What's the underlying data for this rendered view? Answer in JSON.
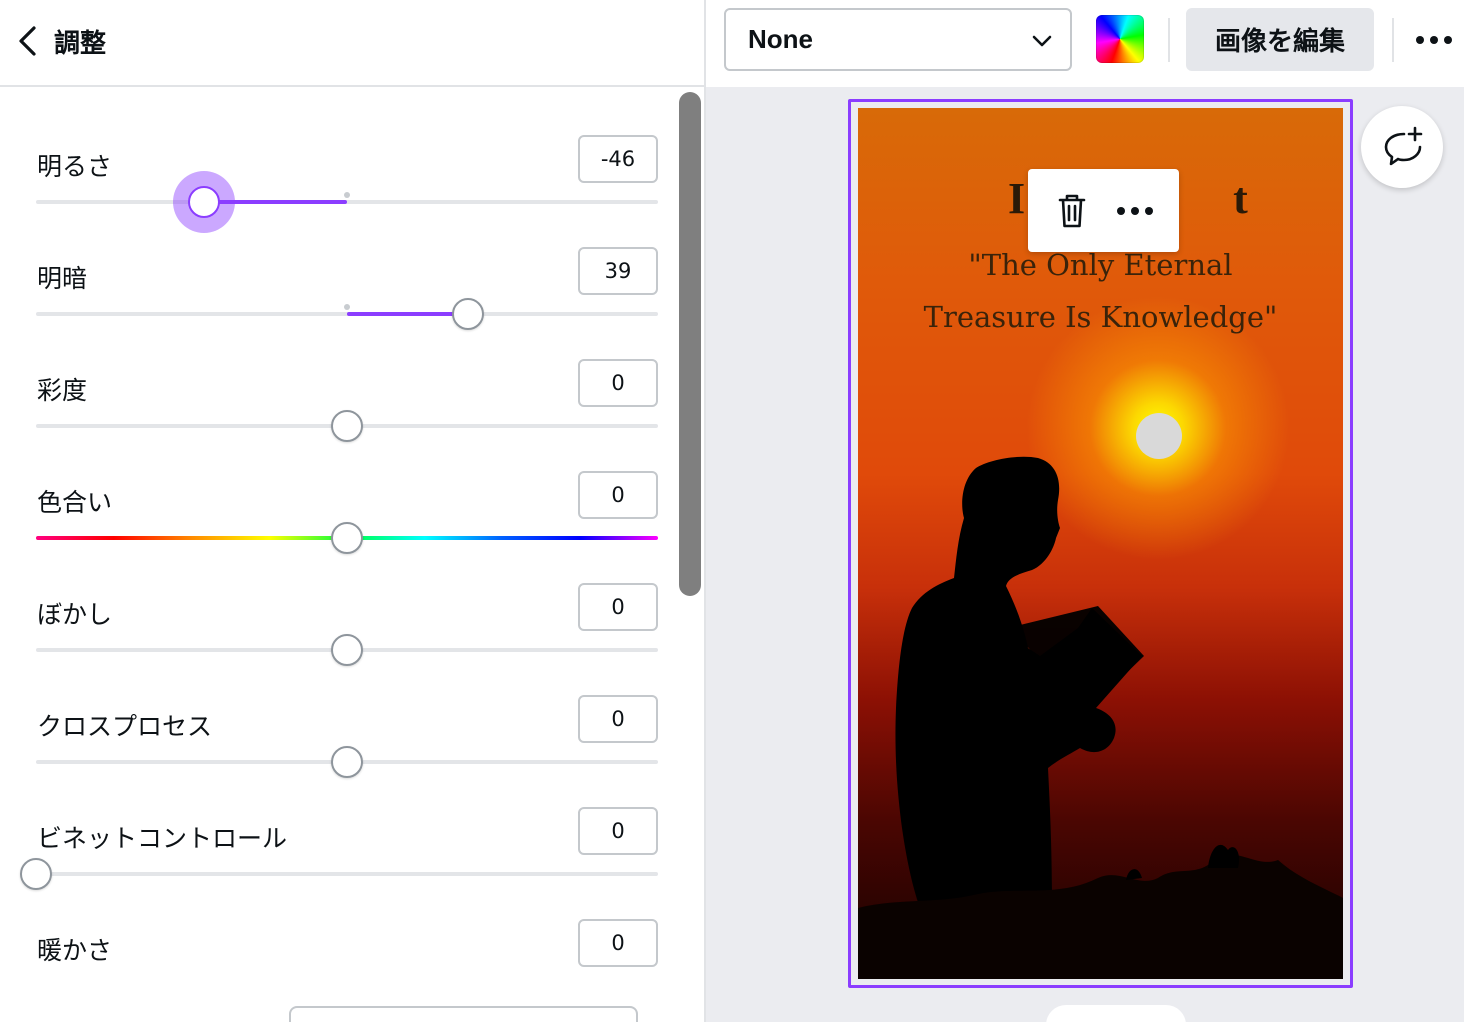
{
  "panel": {
    "title": "調整",
    "back_icon": "chevron-left-icon"
  },
  "adjustments": [
    {
      "id": "brightness",
      "label": "明るさ",
      "value": "-46",
      "level": -46
    },
    {
      "id": "contrast",
      "label": "明暗",
      "value": "39",
      "level": 39
    },
    {
      "id": "saturation",
      "label": "彩度",
      "value": "0",
      "level": 0
    },
    {
      "id": "hue",
      "label": "色合い",
      "value": "0",
      "level": 0
    },
    {
      "id": "blur",
      "label": "ぼかし",
      "value": "0",
      "level": 0
    },
    {
      "id": "xpro",
      "label": "クロスプロセス",
      "value": "0",
      "level": 0
    },
    {
      "id": "vignette",
      "label": "ビネットコントロール",
      "value": "0",
      "level": 0
    },
    {
      "id": "warmth",
      "label": "暖かさ",
      "value": "0",
      "level": 0
    }
  ],
  "toolbar": {
    "font_select_value": "None",
    "edit_image_label": "画像を編集",
    "more_icon": "more-horizontal-icon",
    "color_icon": "rainbow-color-icon"
  },
  "design": {
    "quote_line_1": "\"The Only Eternal",
    "quote_line_2": "Treasure Is Knowledge\"",
    "title_visible_start": "I",
    "title_visible_end": "t"
  },
  "element_toolbar": {
    "delete_icon": "trash-icon",
    "more_icon": "more-horizontal-icon"
  },
  "canvas": {
    "comment_icon": "add-comment-icon"
  },
  "colors": {
    "accent": "#8b3dff",
    "track": "#e3e5e8",
    "border": "#c4c8cc",
    "canvas_bg": "#ebecf0"
  }
}
